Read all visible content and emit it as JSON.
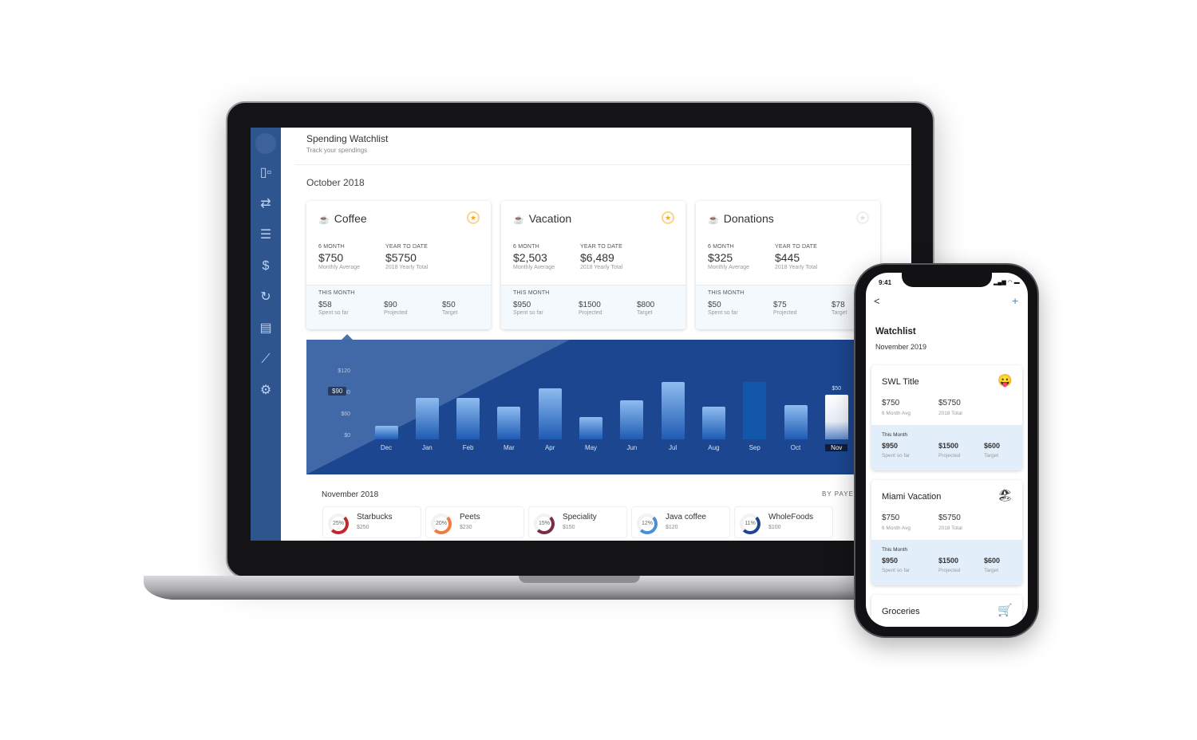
{
  "laptop": {
    "sidebar": {
      "icons": [
        "dashboard-icon",
        "transfer-icon",
        "accounts-icon",
        "bills-icon",
        "recurring-icon",
        "reports-icon",
        "chart-icon",
        "gear-icon"
      ]
    },
    "header": {
      "title": "Spending Watchlist",
      "subtitle": "Track your spendings"
    },
    "period": "October 2018",
    "cards": [
      {
        "title": "Coffee",
        "starred": true,
        "six_month_label": "6 MONTH",
        "six_month": "$750",
        "six_month_sub": "Monthly Average",
        "ytd_label": "YEAR TO DATE",
        "ytd": "$5750",
        "ytd_sub": "2018 Yearly Total",
        "this_month_label": "THIS MONTH",
        "spent": "$58",
        "spent_label": "Spent so far",
        "projected": "$90",
        "projected_label": "Projected",
        "target": "$50",
        "target_label": "Target"
      },
      {
        "title": "Vacation",
        "starred": true,
        "six_month_label": "6 MONTH",
        "six_month": "$2,503",
        "six_month_sub": "Monthly Average",
        "ytd_label": "YEAR TO DATE",
        "ytd": "$6,489",
        "ytd_sub": "2018 Yearly Total",
        "this_month_label": "THIS MONTH",
        "spent": "$950",
        "spent_label": "Spent so far",
        "projected": "$1500",
        "projected_label": "Projected",
        "target": "$800",
        "target_label": "Target"
      },
      {
        "title": "Donations",
        "starred": false,
        "six_month_label": "6 MONTH",
        "six_month": "$325",
        "six_month_sub": "Monthly Average",
        "ytd_label": "YEAR TO DATE",
        "ytd": "$445",
        "ytd_sub": "2018 Yearly Total",
        "this_month_label": "THIS MONTH",
        "spent": "$50",
        "spent_label": "Spent so far",
        "projected": "$75",
        "projected_label": "Projected",
        "target": "$78",
        "target_label": "Target"
      }
    ],
    "bottom": {
      "title": "November 2018",
      "by_label": "BY PAYEE",
      "payees": [
        {
          "name": "Starbucks",
          "amount": "$250",
          "pct": "25%",
          "color": "#c0282d"
        },
        {
          "name": "Peets",
          "amount": "$230",
          "pct": "20%",
          "color": "#f07b3f"
        },
        {
          "name": "Speciality",
          "amount": "$150",
          "pct": "15%",
          "color": "#7a2d4a"
        },
        {
          "name": "Java coffee",
          "amount": "$120",
          "pct": "12%",
          "color": "#4a90d9"
        },
        {
          "name": "WholeFoods",
          "amount": "$100",
          "pct": "11%",
          "color": "#1c4690"
        }
      ]
    }
  },
  "chart_data": {
    "type": "bar",
    "categories": [
      "Dec",
      "Jan",
      "Feb",
      "Mar",
      "Apr",
      "May",
      "Jun",
      "Jul",
      "Aug",
      "Sep",
      "Oct",
      "Nov"
    ],
    "values": [
      25,
      77,
      77,
      61,
      95,
      41,
      72,
      107,
      61,
      107,
      64,
      83
    ],
    "ylim": [
      0,
      120
    ],
    "y_tick_labels": [
      "$0",
      "$60",
      "$80",
      "$120"
    ],
    "highlight_value_label": "$90",
    "selected": "Nov",
    "selected_value_label": "$50",
    "grid": false
  },
  "phone": {
    "time": "9:41",
    "title": "Watchlist",
    "subtitle": "November 2019",
    "add_label": "+",
    "back_label": "<",
    "cards": [
      {
        "title": "SWL Title",
        "emoji": "😛",
        "avg": "$750",
        "avg_label": "6 Month Avg",
        "total": "$5750",
        "total_label": "2018 Total",
        "this_month": "This Month",
        "spent": "$950",
        "spent_label": "Spent so far",
        "projected": "$1500",
        "projected_label": "Projected",
        "target": "$600",
        "target_label": "Target"
      },
      {
        "title": "Miami Vacation",
        "emoji": "🏖",
        "avg": "$750",
        "avg_label": "6 Month Avg",
        "total": "$5750",
        "total_label": "2018 Total",
        "this_month": "This Month",
        "spent": "$950",
        "spent_label": "Spent so far",
        "projected": "$1500",
        "projected_label": "Projected",
        "target": "$600",
        "target_label": "Target"
      },
      {
        "title": "Groceries",
        "emoji": "🛒"
      }
    ]
  }
}
